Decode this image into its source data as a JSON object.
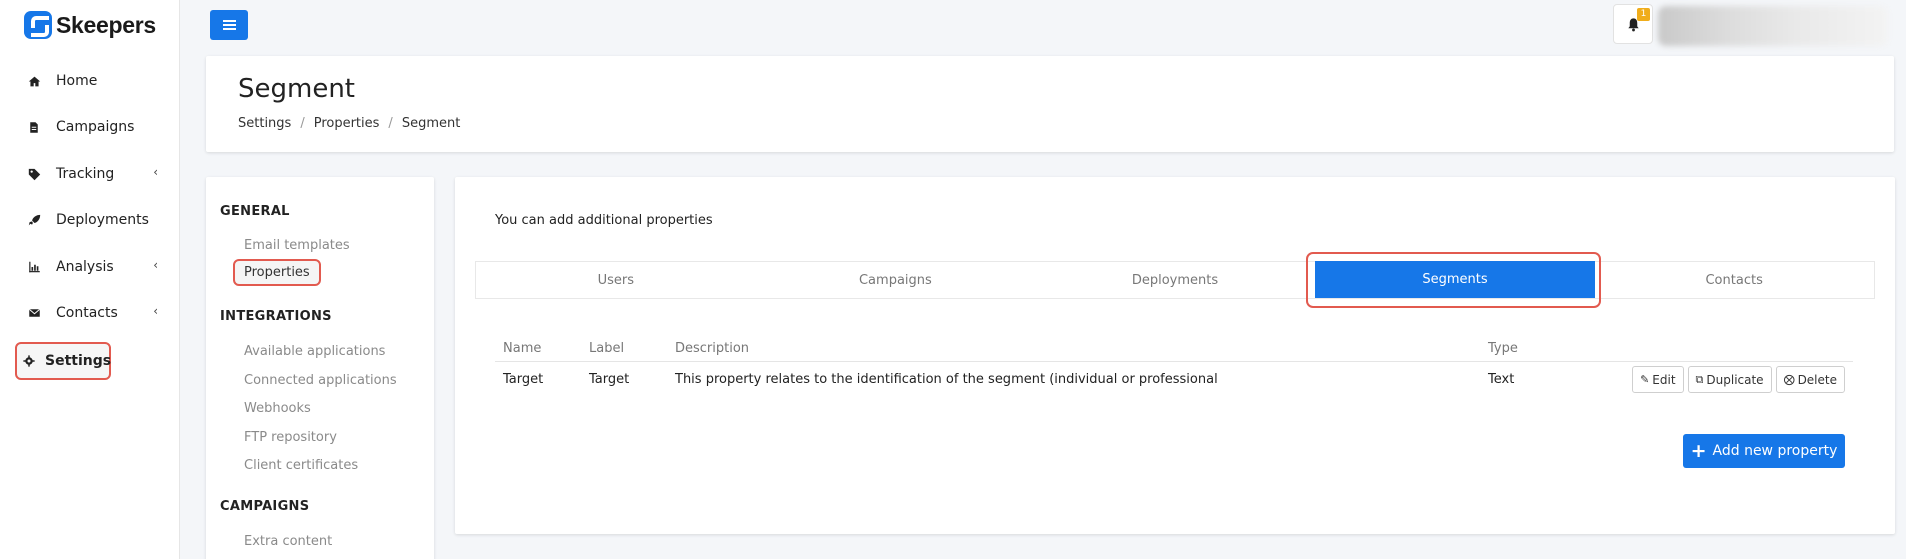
{
  "brand": {
    "name": "Skeepers",
    "accent": "#1677e8"
  },
  "sidebar": {
    "items": [
      {
        "label": "Home",
        "icon": "home-icon",
        "has_submenu": false
      },
      {
        "label": "Campaigns",
        "icon": "file-icon",
        "has_submenu": false
      },
      {
        "label": "Tracking",
        "icon": "tag-icon",
        "has_submenu": true
      },
      {
        "label": "Deployments",
        "icon": "rocket-icon",
        "has_submenu": false
      },
      {
        "label": "Analysis",
        "icon": "bar-chart-icon",
        "has_submenu": true
      },
      {
        "label": "Contacts",
        "icon": "envelope-icon",
        "has_submenu": true
      },
      {
        "label": "Settings",
        "icon": "gear-icon",
        "has_submenu": false,
        "active": true
      }
    ]
  },
  "topbar": {
    "menu_icon": "hamburger-icon",
    "notifications": {
      "icon": "bell-icon",
      "count": "1",
      "badge_color": "#f0ad1b"
    }
  },
  "header": {
    "title": "Segment",
    "breadcrumb": [
      "Settings",
      "Properties",
      "Segment"
    ]
  },
  "settings_menu": {
    "sections": [
      {
        "title": "GENERAL",
        "items": [
          "Email templates",
          "Properties"
        ]
      },
      {
        "title": "INTEGRATIONS",
        "items": [
          "Available applications",
          "Connected applications",
          "Webhooks",
          "FTP repository",
          "Client certificates"
        ]
      },
      {
        "title": "CAMPAIGNS",
        "items": [
          "Extra content"
        ]
      }
    ],
    "selected": "Properties"
  },
  "main": {
    "intro": "You can add additional properties",
    "tabs": [
      "Users",
      "Campaigns",
      "Deployments",
      "Segments",
      "Contacts"
    ],
    "active_tab": "Segments",
    "table": {
      "columns": [
        "Name",
        "Label",
        "Description",
        "Type"
      ],
      "rows": [
        {
          "name": "Target",
          "label": "Target",
          "description": "This property relates to the identification of the segment (individual or professional",
          "type": "Text"
        }
      ],
      "row_actions": {
        "edit": "Edit",
        "duplicate": "Duplicate",
        "delete": "Delete"
      }
    },
    "add_button": "Add new property"
  },
  "colors": {
    "highlight": "#e25a4f",
    "muted_text": "#8a8a8a"
  }
}
